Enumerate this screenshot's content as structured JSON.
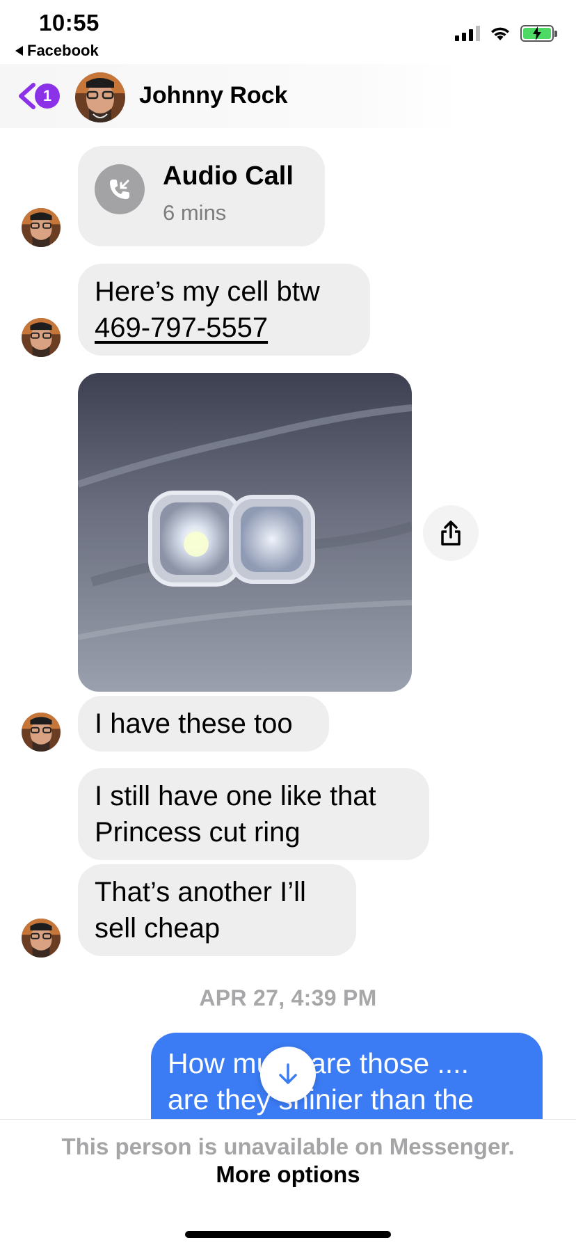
{
  "status_bar": {
    "time": "10:55",
    "back_app": "Facebook"
  },
  "header": {
    "unread_count": "1",
    "contact_name": "Johnny Rock"
  },
  "messages": {
    "call": {
      "title": "Audio Call",
      "duration": "6 mins"
    },
    "cell_line1": "Here’s my cell btw",
    "cell_phone": "469-797-5557",
    "have_these": "I have these too",
    "still_have_line1": "I still have one like that",
    "still_have_line2": "Princess cut ring",
    "another_line1": "That’s another I’ll",
    "another_line2": "sell cheap",
    "timestamp": "APR 27, 4:39 PM",
    "mine_line1": "How much are those ....",
    "mine_line2": "are they shinier than the"
  },
  "footer": {
    "unavailable": "This person is unavailable on Messenger.",
    "more_options": "More options"
  },
  "colors": {
    "accent_purple": "#8b31e8",
    "my_bubble": "#3b7cf5",
    "their_bubble": "#eeeeef",
    "muted_text": "#a5a5a7"
  },
  "icons": [
    "chevron-left-icon",
    "phone-incoming-icon",
    "share-icon",
    "arrow-down-icon",
    "signal-icon",
    "wifi-icon",
    "battery-charging-icon"
  ]
}
